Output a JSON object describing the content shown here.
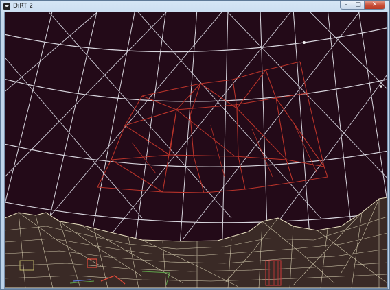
{
  "window": {
    "title": "DiRT 2",
    "minimize_glyph": "–",
    "maximize_glyph": "□",
    "close_glyph": "✕"
  },
  "colors": {
    "sky": "#230a18",
    "grid_lines": "#d9d9e0",
    "wireframe_structure": "#b8332a",
    "terrain": "#e8e0c0"
  },
  "icons": {
    "app": "dirt-app-icon"
  }
}
